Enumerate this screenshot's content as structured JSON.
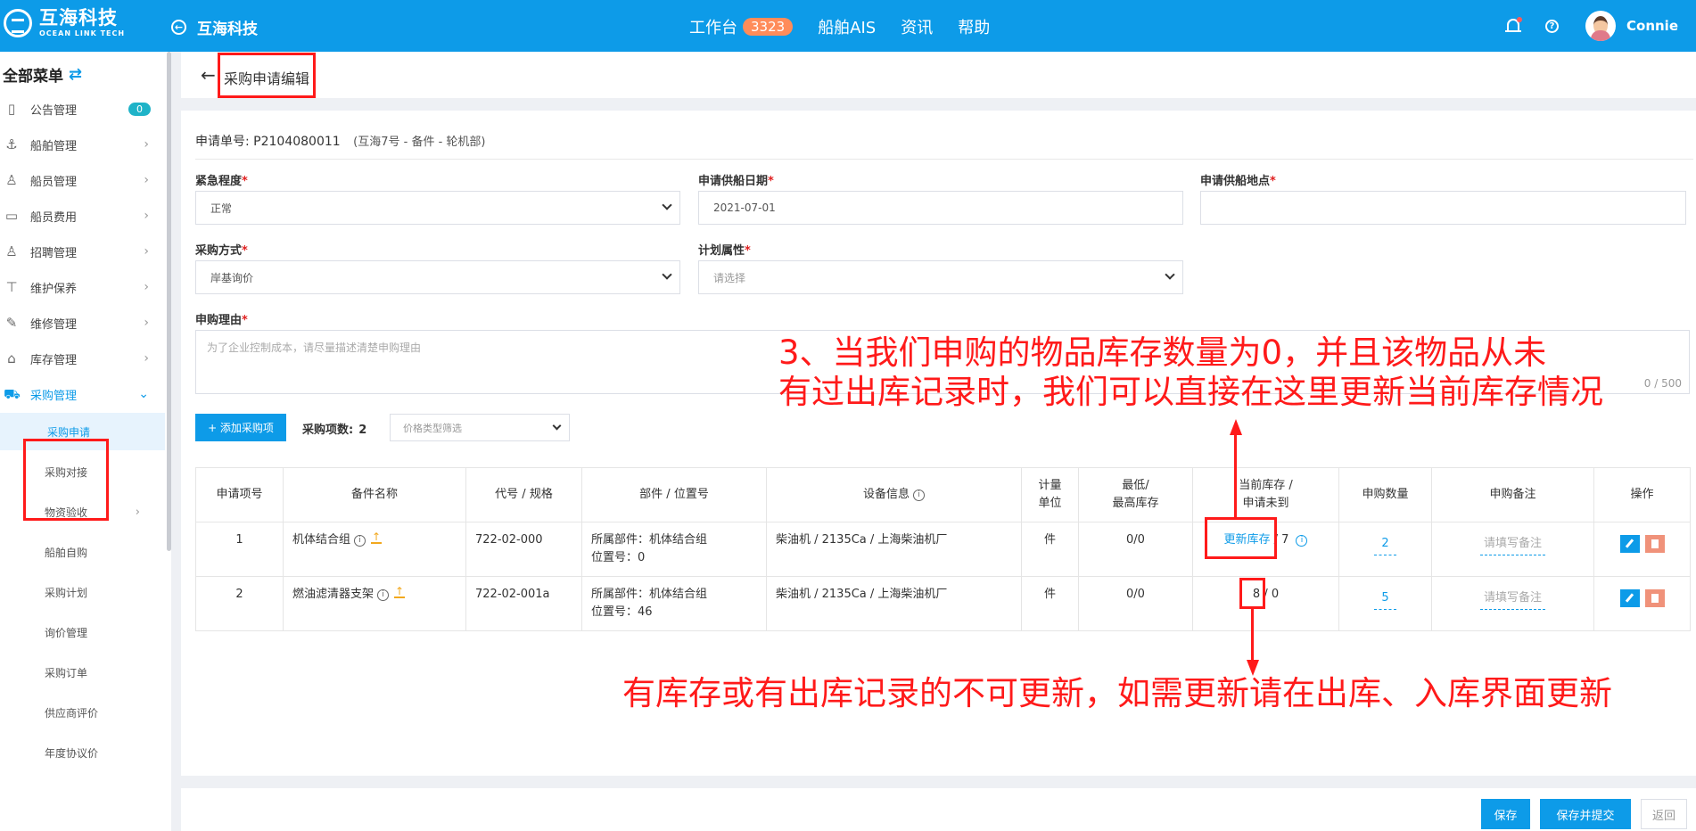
{
  "header": {
    "logo_cn": "互海科技",
    "logo_en": "OCEAN LINK TECH",
    "brand": "互海科技",
    "nav": [
      {
        "label": "工作台",
        "badge": "3323"
      },
      {
        "label": "船舶AIS"
      },
      {
        "label": "资讯"
      },
      {
        "label": "帮助"
      }
    ],
    "user": "Connie"
  },
  "sidebar": {
    "title": "全部菜单",
    "items": [
      {
        "label": "公告管理",
        "icon": "book-icon",
        "badge": "0"
      },
      {
        "label": "船舶管理",
        "icon": "anchor-icon"
      },
      {
        "label": "船员管理",
        "icon": "user-icon"
      },
      {
        "label": "船员费用",
        "icon": "wallet-icon"
      },
      {
        "label": "招聘管理",
        "icon": "recruit-icon"
      },
      {
        "label": "维护保养",
        "icon": "tool-icon"
      },
      {
        "label": "维修管理",
        "icon": "wrench-icon"
      },
      {
        "label": "库存管理",
        "icon": "warehouse-icon"
      },
      {
        "label": "采购管理",
        "icon": "cart-icon"
      }
    ],
    "sub_items": [
      "采购申请",
      "采购对接",
      "物资验收",
      "船舶自购",
      "采购计划",
      "询价管理",
      "采购订单",
      "供应商评价",
      "年度协议价"
    ]
  },
  "page": {
    "title": "采购申请编辑",
    "request_label": "申请单号:",
    "request_no": "P2104080011",
    "request_sub": "(互海7号 - 备件 - 轮机部)"
  },
  "form": {
    "urgency_label": "紧急程度",
    "urgency_value": "正常",
    "supply_date_label": "申请供船日期",
    "supply_date_value": "2021-07-01",
    "supply_place_label": "申请供船地点",
    "method_label": "采购方式",
    "method_value": "岸基询价",
    "plan_label": "计划属性",
    "plan_placeholder": "请选择",
    "reason_label": "申购理由",
    "reason_placeholder": "为了企业控制成本，请尽量描述清楚申购理由",
    "reason_count": "0 / 500"
  },
  "toolbar": {
    "add_label": "+ 添加采购项",
    "items_label": "采购项数:",
    "items_count": "2",
    "filter_placeholder": "价格类型筛选"
  },
  "table": {
    "headers": [
      "申请项号",
      "备件名称",
      "代号 / 规格",
      "部件 / 位置号",
      "设备信息",
      "计量单位",
      "最低/最高库存",
      "当前库存 / 申请未到",
      "申购数量",
      "申购备注",
      "操作"
    ],
    "header_lines": {
      "unit_1": "计量",
      "unit_2": "单位",
      "stock_1": "最低/",
      "stock_2": "最高库存",
      "current_1": "当前库存 /",
      "current_2": "申请未到"
    },
    "rows": [
      {
        "no": "1",
        "name": "机体结合组",
        "code": "722-02-000",
        "part": "所属部件：机体结合组",
        "position": "位置号：0",
        "equipment": "柴油机 / 2135Ca / 上海柴油机厂",
        "unit": "件",
        "minmax": "0/0",
        "current": "更新库存",
        "pending": "/ 7",
        "qty": "2",
        "remark": "请填写备注"
      },
      {
        "no": "2",
        "name": "燃油滤清器支架",
        "code": "722-02-001a",
        "part": "所属部件：机体结合组",
        "position": "位置号：46",
        "equipment": "柴油机 / 2135Ca / 上海柴油机厂",
        "unit": "件",
        "minmax": "0/0",
        "current": "8",
        "pending": "/ 0",
        "qty": "5",
        "remark": "请填写备注"
      }
    ]
  },
  "annotations": {
    "note_top_line1": "3、当我们申购的物品库存数量为0，并且该物品从未",
    "note_top_line2": "有过出库记录时，我们可以直接在这里更新当前库存情况",
    "note_bottom": "有库存或有出库记录的不可更新，如需更新请在出库、入库界面更新"
  },
  "footer": {
    "save": "保存",
    "save_submit": "保存并提交",
    "back": "返回"
  },
  "colors": {
    "primary": "#0d9be8",
    "annotation": "#ff1a1a",
    "badge": "#ff8c5a"
  }
}
